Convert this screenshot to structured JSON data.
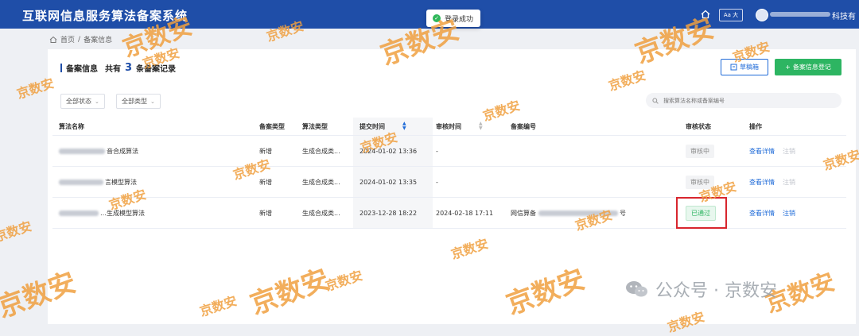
{
  "app": {
    "title": "互联网信息服务算法备案系统"
  },
  "header": {
    "font_toggle": "Aa 大",
    "user_suffix": "科技有",
    "icons": {
      "home": "home-icon",
      "avatar": "user-avatar"
    }
  },
  "toast": {
    "text": "登录成功",
    "icon": "check-circle-icon",
    "color": "#2fb75a"
  },
  "breadcrumb": {
    "home": "首页",
    "separator": "/",
    "current": "备案信息"
  },
  "section": {
    "title": "备案信息",
    "total_prefix": "共有",
    "count": "3",
    "total_suffix": "条备案记录"
  },
  "buttons": {
    "draft": "草稿箱",
    "add": "备案信息登记"
  },
  "filters": {
    "status": "全部状态",
    "type": "全部类型"
  },
  "search": {
    "placeholder": "搜索算法名称或备案编号"
  },
  "table": {
    "columns": {
      "name": "算法名称",
      "type": "备案类型",
      "algo": "算法类型",
      "submit": "提交时间",
      "review": "审核时间",
      "record": "备案编号",
      "status": "审核状态",
      "ops": "操作"
    },
    "rows": [
      {
        "name": "音合成算法",
        "type": "新增",
        "algo": "生成合成类...",
        "submit": "2024-01-02 13:36",
        "review": "-",
        "record_prefix": "",
        "record_suffix": "",
        "status": "审核中",
        "view": "查看详情",
        "cancel": "注销"
      },
      {
        "name": "言模型算法",
        "type": "新增",
        "algo": "生成合成类...",
        "submit": "2024-01-02 13:35",
        "review": "-",
        "record_prefix": "",
        "record_suffix": "",
        "status": "审核中",
        "view": "查看详情",
        "cancel": "注销"
      },
      {
        "name": "…生成模型算法",
        "type": "新增",
        "algo": "生成合成类...",
        "submit": "2023-12-28 18:22",
        "review": "2024-02-18 17:11",
        "record_prefix": "网信算备",
        "record_suffix": "号",
        "status": "已通过",
        "view": "查看详情",
        "cancel": "注销"
      }
    ]
  },
  "watermark": {
    "text": "京数安",
    "color": "#f0a040"
  },
  "footer_mark": {
    "text": "公众号 · 京数安",
    "icon": "wechat-icon"
  },
  "colors": {
    "header": "#1f4ea8",
    "primary": "#1f6bd8",
    "success": "#2db562",
    "highlight": "#d8262e"
  }
}
